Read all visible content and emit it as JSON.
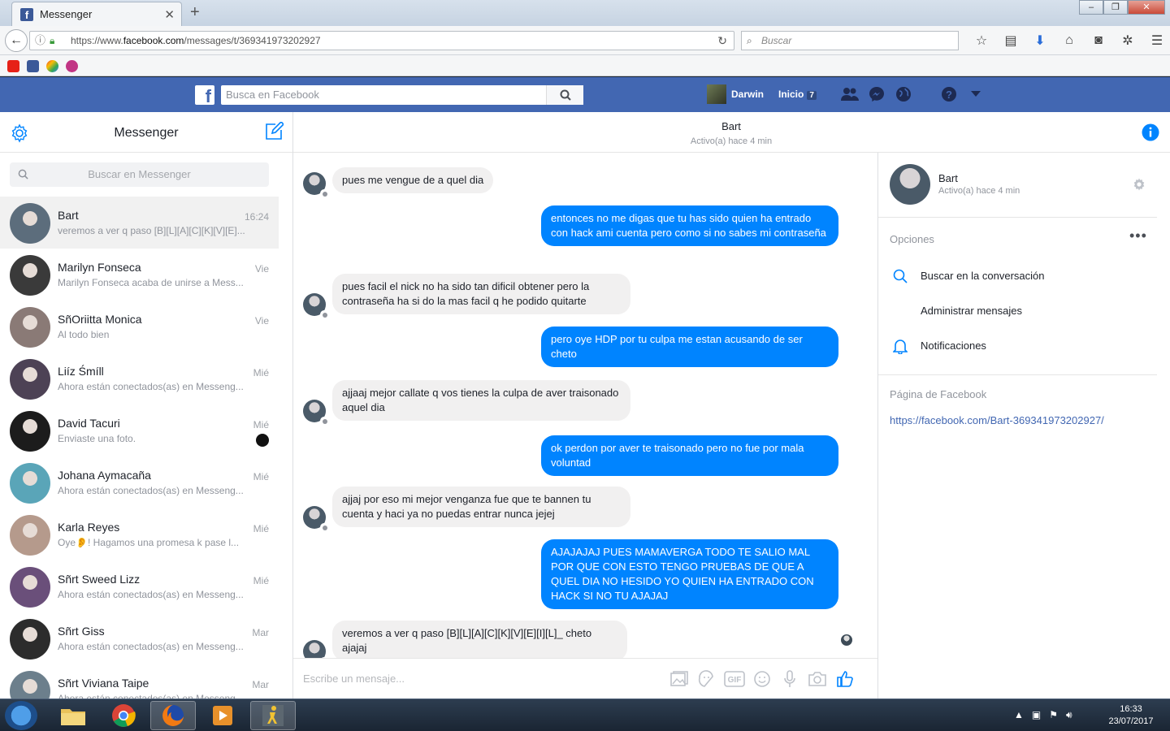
{
  "browser": {
    "tab_title": "Messenger",
    "url_prefix": "https://www.",
    "url_domain": "facebook.com",
    "url_path": "/messages/t/369341973202927",
    "search_placeholder": "Buscar"
  },
  "facebook": {
    "search_placeholder": "Busca en Facebook",
    "user_name": "Darwin",
    "home_label": "Inicio",
    "home_count": "7"
  },
  "messenger": {
    "title": "Messenger",
    "search_placeholder": "Buscar en Messenger",
    "conversations": [
      {
        "name": "Bart",
        "time": "16:24",
        "preview": "veremos a ver q paso [B][L][A][C][K][V][E]...",
        "color": "#5c6d7c"
      },
      {
        "name": "Marilyn Fonseca",
        "time": "Vie",
        "preview": "Marilyn Fonseca acaba de unirse a Mess...",
        "color": "#3a3a3a"
      },
      {
        "name": "SñOriitta Monica",
        "time": "Vie",
        "preview": "Al todo bien",
        "color": "#8a7a76"
      },
      {
        "name": "Liíz Śmíll",
        "time": "Mié",
        "preview": "Ahora están conectados(as) en Messeng...",
        "color": "#4d4255"
      },
      {
        "name": "David Tacuri",
        "time": "Mié",
        "preview": "Enviaste una foto.",
        "color": "#1c1c1c"
      },
      {
        "name": "Johana Aymacaña",
        "time": "Mié",
        "preview": "Ahora están conectados(as) en Messeng...",
        "color": "#5aa5b8"
      },
      {
        "name": "Karla Reyes",
        "time": "Mié",
        "preview": "Oye👂! Hagamos una promesa k pase l...",
        "color": "#b59a8c"
      },
      {
        "name": "Sñrt Sweed Lizz",
        "time": "Mié",
        "preview": "Ahora están conectados(as) en Messeng...",
        "color": "#6a4f7a"
      },
      {
        "name": "Sñrt Giss",
        "time": "Mar",
        "preview": "Ahora están conectados(as) en Messeng...",
        "color": "#2c2c2c"
      },
      {
        "name": "Sñrt Viviana Taipe",
        "time": "Mar",
        "preview": "Ahora están conectados(as) en Messeng...",
        "color": "#6c7f8c"
      }
    ]
  },
  "chat": {
    "contact_name": "Bart",
    "status": "Activo(a) hace 4 min",
    "composer_placeholder": "Escribe un mensaje...",
    "messages": [
      {
        "dir": "in",
        "text": "pues me vengue de a quel dia"
      },
      {
        "dir": "out",
        "text": "entonces no me digas que tu has sido quien ha entrado con hack ami cuenta pero como si no sabes mi contraseña"
      },
      {
        "dir": "in",
        "text": "pues facil el nick no ha sido tan dificil obtener pero la contraseña ha si do la mas facil q he podido quitarte"
      },
      {
        "dir": "out",
        "text": "pero oye HDP por tu culpa me estan acusando de ser cheto"
      },
      {
        "dir": "in",
        "text": "ajjaaj mejor callate q vos tienes la culpa de aver traisonado aquel dia"
      },
      {
        "dir": "out",
        "text": "ok perdon por aver te traisonado pero no fue por mala voluntad"
      },
      {
        "dir": "in",
        "text": "ajjaj por eso mi mejor venganza fue que te bannen tu cuenta y haci ya no puedas entrar nunca jejej"
      },
      {
        "dir": "out",
        "text": "AJAJAJAJ PUES MAMAVERGA TODO TE SALIO MAL POR QUE CON ESTO TENGO PRUEBAS DE QUE A QUEL DIA NO HESIDO YO QUIEN HA ENTRADO CON HACK SI NO TU AJAJAJ"
      },
      {
        "dir": "in",
        "text": "veremos a ver q paso [B][L][A][C][K][V][E][I][L]_ cheto ajajaj"
      }
    ]
  },
  "details": {
    "name": "Bart",
    "status": "Activo(a) hace 4 min",
    "options_heading": "Opciones",
    "options": [
      "Buscar en la conversación",
      "Administrar mensajes",
      "Notificaciones"
    ],
    "page_heading": "Página de Facebook",
    "page_link": "https://facebook.com/Bart-369341973202927/"
  },
  "taskbar": {
    "time": "16:33",
    "date": "23/07/2017"
  },
  "colors": {
    "fb_blue": "#4267b2",
    "messenger_blue": "#0084ff"
  }
}
